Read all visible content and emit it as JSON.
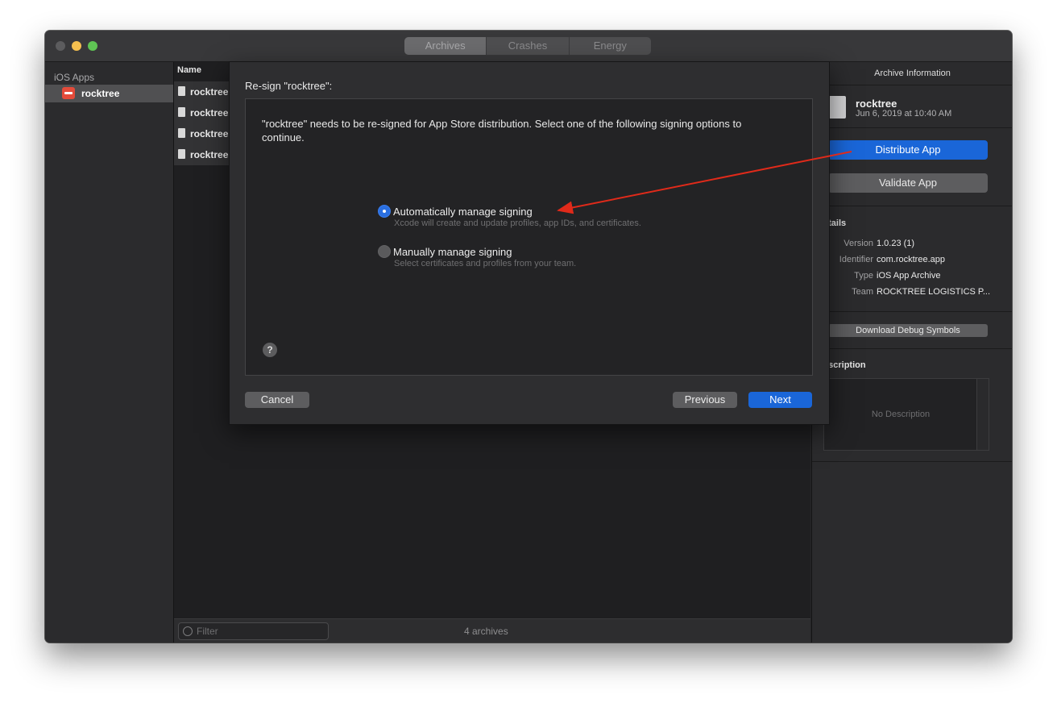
{
  "titlebar": {
    "tabs": [
      "Archives",
      "Crashes",
      "Energy"
    ],
    "active_tab": "Archives"
  },
  "sidebar": {
    "section_title": "iOS Apps",
    "items": [
      {
        "label": "rocktree"
      }
    ]
  },
  "archive_list": {
    "column_header": "Name",
    "rows": [
      {
        "name": "rocktree"
      },
      {
        "name": "rocktree"
      },
      {
        "name": "rocktree"
      },
      {
        "name": "rocktree"
      }
    ]
  },
  "bottom_bar": {
    "filter_placeholder": "Filter",
    "archive_count": "4 archives"
  },
  "inspector": {
    "title": "Archive Information",
    "app_name": "rocktree",
    "app_date": "Jun 6, 2019 at 10:40 AM",
    "distribute_label": "Distribute App",
    "validate_label": "Validate App",
    "details_title": "etails",
    "details": [
      {
        "key": "Version",
        "value": "1.0.23 (1)"
      },
      {
        "key": "Identifier",
        "value": "com.rocktree.app"
      },
      {
        "key": "Type",
        "value": "iOS App Archive"
      },
      {
        "key": "Team",
        "value": "ROCKTREE LOGISTICS P..."
      }
    ],
    "download_symbols_label": "Download Debug Symbols",
    "description_title": "escription",
    "description_placeholder": "No Description"
  },
  "sheet": {
    "title": "Re-sign \"rocktree\":",
    "message": "\"rocktree\" needs to be re-signed for App Store distribution. Select one of the following signing options to continue.",
    "options": [
      {
        "label": "Automatically manage signing",
        "sublabel": "Xcode will create and update profiles, app IDs, and certificates.",
        "selected": true
      },
      {
        "label": "Manually manage signing",
        "sublabel": "Select certificates and profiles from your team.",
        "selected": false
      }
    ],
    "help_label": "?",
    "cancel_label": "Cancel",
    "previous_label": "Previous",
    "next_label": "Next"
  },
  "colors": {
    "accent_blue": "#1a66d8",
    "annotation_arrow": "#e02a1a"
  }
}
